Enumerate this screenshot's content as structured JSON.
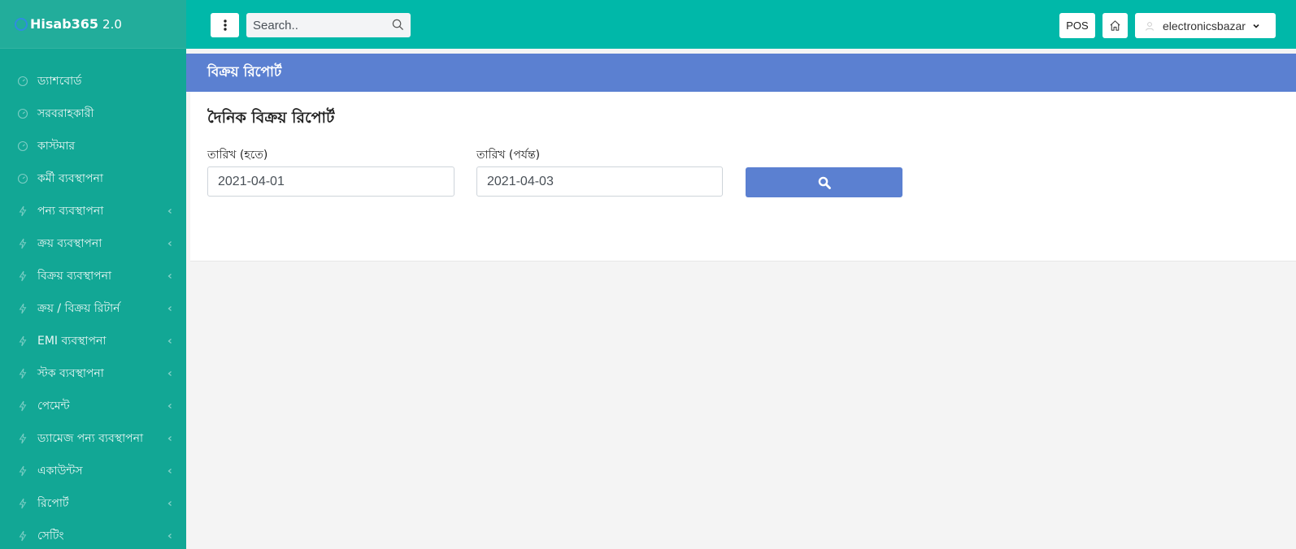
{
  "brand": {
    "name": "Hisab365",
    "version": "2.0"
  },
  "sidebar": {
    "items": [
      {
        "label": "ড্যাশবোর্ড",
        "icon": "gauge-icon",
        "has_submenu": false
      },
      {
        "label": "সরবরাহকারী",
        "icon": "gauge-icon",
        "has_submenu": false
      },
      {
        "label": "কাস্টমার",
        "icon": "gauge-icon",
        "has_submenu": false
      },
      {
        "label": "কর্মী ব্যবস্থাপনা",
        "icon": "gauge-icon",
        "has_submenu": false
      },
      {
        "label": "পন্য ব্যবস্থাপনা",
        "icon": "bolt-icon",
        "has_submenu": true
      },
      {
        "label": "ক্রয় ব্যবস্থাপনা",
        "icon": "bolt-icon",
        "has_submenu": true
      },
      {
        "label": "বিক্রয় ব্যবস্থাপনা",
        "icon": "bolt-icon",
        "has_submenu": true
      },
      {
        "label": "ক্রয় / বিক্রয় রিটার্ন",
        "icon": "bolt-icon",
        "has_submenu": true
      },
      {
        "label": "EMI ব্যবস্থাপনা",
        "icon": "bolt-icon",
        "has_submenu": true
      },
      {
        "label": "স্টক ব্যবস্থাপনা",
        "icon": "bolt-icon",
        "has_submenu": true
      },
      {
        "label": "পেমেন্ট",
        "icon": "bolt-icon",
        "has_submenu": true
      },
      {
        "label": "ড্যামেজ পন্য ব্যবস্থাপনা",
        "icon": "bolt-icon",
        "has_submenu": true
      },
      {
        "label": "একাউন্টস",
        "icon": "bolt-icon",
        "has_submenu": true
      },
      {
        "label": "রিপোর্ট",
        "icon": "bolt-icon",
        "has_submenu": true
      },
      {
        "label": "সেটিং",
        "icon": "bolt-icon",
        "has_submenu": true
      }
    ]
  },
  "topbar": {
    "search_placeholder": "Search..",
    "pos_label": "POS",
    "user_name": "electronicsbazar"
  },
  "page": {
    "header": "বিক্রয় রিপোর্ট",
    "card_title": "দৈনিক বিক্রয় রিপোর্ট",
    "from_label": "তারিখ (হতে)",
    "from_value": "2021-04-01",
    "to_label": "তারিখ (পর্যন্ত)",
    "to_value": "2021-04-03"
  },
  "colors": {
    "sidebar": "#12a795",
    "topbar": "#00b8a9",
    "accent": "#5b80d1"
  }
}
